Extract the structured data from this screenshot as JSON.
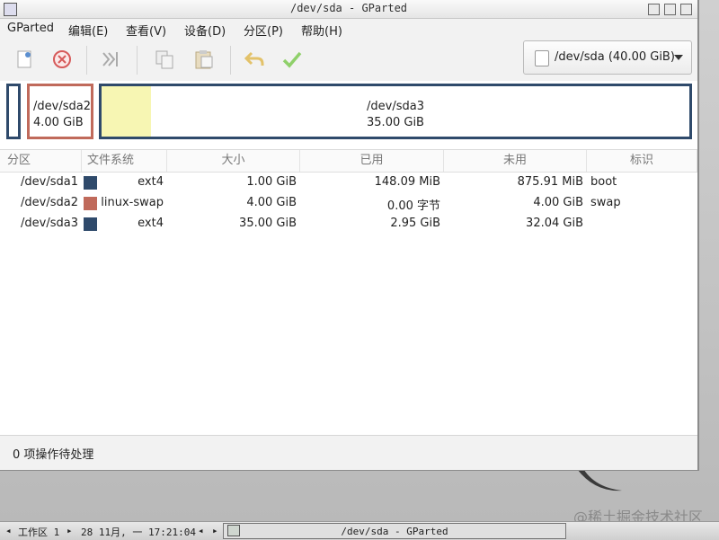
{
  "window": {
    "title": "/dev/sda - GParted"
  },
  "menubar": {
    "items": [
      "GParted",
      "编辑(E)",
      "查看(V)",
      "设备(D)",
      "分区(P)",
      "帮助(H)"
    ]
  },
  "toolbar": {
    "icons": [
      "new-partition-icon",
      "delete-icon",
      "resize-move-icon",
      "copy-icon",
      "paste-icon",
      "undo-icon",
      "apply-icon"
    ],
    "device_selector": "/dev/sda  (40.00 GiB)"
  },
  "diskmap": {
    "sda2": {
      "name": "/dev/sda2",
      "size": "4.00 GiB"
    },
    "sda3": {
      "name": "/dev/sda3",
      "size": "35.00 GiB"
    }
  },
  "table": {
    "headers": [
      "分区",
      "文件系统",
      "大小",
      "已用",
      "未用",
      "标识"
    ],
    "rows": [
      {
        "partition": "/dev/sda1",
        "fs": "ext4",
        "size": "1.00 GiB",
        "used": "148.09 MiB",
        "unused": "875.91 MiB",
        "flags": "boot",
        "color": "#2f4a6b"
      },
      {
        "partition": "/dev/sda2",
        "fs": "linux-swap",
        "size": "4.00 GiB",
        "used": "0.00 字节",
        "unused": "4.00 GiB",
        "flags": "swap",
        "color": "#c06a5b"
      },
      {
        "partition": "/dev/sda3",
        "fs": "ext4",
        "size": "35.00 GiB",
        "used": "2.95 GiB",
        "unused": "32.04 GiB",
        "flags": "",
        "color": "#2f4a6b"
      }
    ]
  },
  "status": {
    "text": "0 项操作待处理"
  },
  "taskbar": {
    "workspace": "工作区 1",
    "datetime": "28 11月, 一 17:21:04",
    "task": "/dev/sda - GParted"
  },
  "watermark": "@稀土掘金技术社区",
  "colors": {
    "ext4": "#2f4a6b",
    "swap": "#c06a5b",
    "used": "#f7f6b3"
  }
}
